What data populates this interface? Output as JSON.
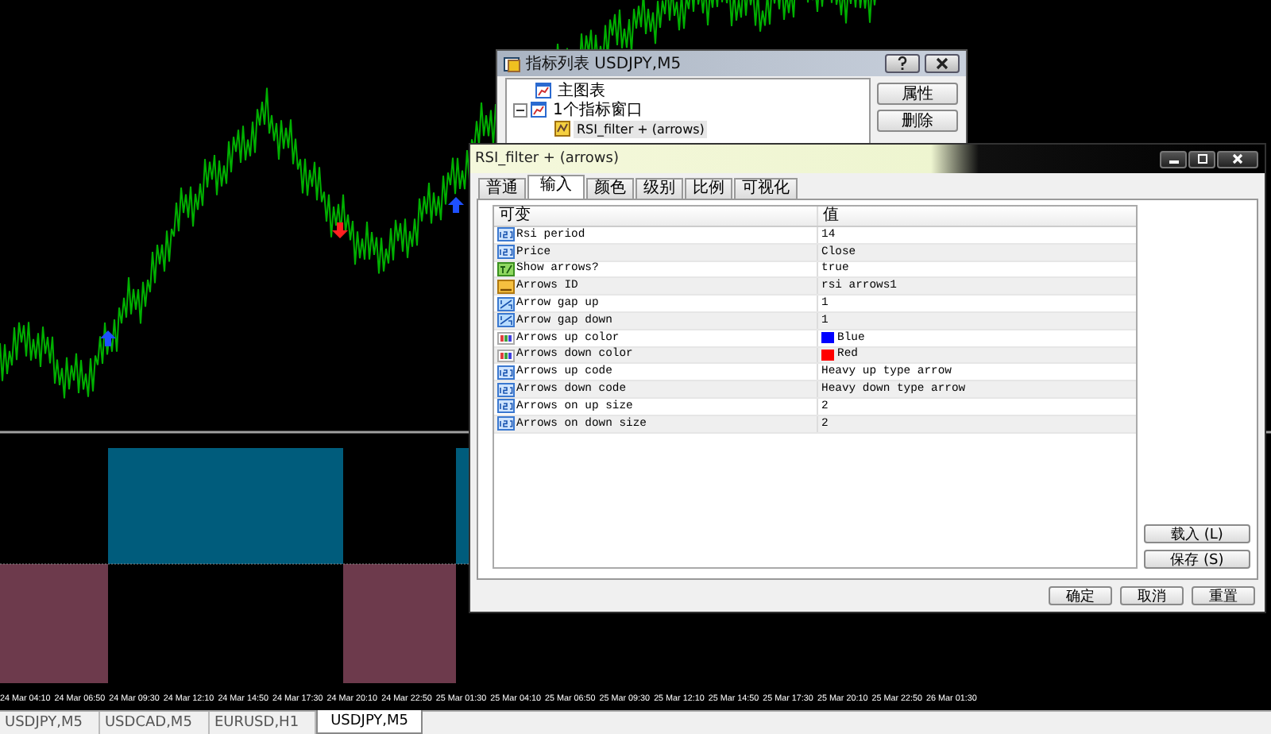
{
  "chart": {
    "time_axis": [
      "24 Mar 04:10",
      "24 Mar 06:50",
      "24 Mar 09:30",
      "24 Mar 12:10",
      "24 Mar 14:50",
      "24 Mar 17:30",
      "24 Mar 20:10",
      "24 Mar 22:50",
      "25 Mar 01:30",
      "25 Mar 04:10",
      "25 Mar 06:50",
      "25 Mar 09:30",
      "25 Mar 12:10",
      "25 Mar 14:50",
      "25 Mar 17:30",
      "25 Mar 20:10",
      "25 Mar 22:50",
      "26 Mar 01:30"
    ]
  },
  "indicator_list_dialog": {
    "title": "指标列表 USDJPY,M5",
    "tree": [
      {
        "label": "主图表",
        "kind": "chart",
        "expanded": false,
        "selected": false
      },
      {
        "label": "1个指标窗口",
        "kind": "chart",
        "expanded": true,
        "selected": false,
        "children": [
          {
            "label": "RSI_filter + (arrows)",
            "kind": "indicator",
            "expanded": false,
            "selected": true
          }
        ]
      }
    ],
    "buttons": [
      "属性",
      "删除"
    ]
  },
  "properties_dialog": {
    "title": "RSI_filter + (arrows)",
    "tabs": [
      {
        "label": "普通",
        "selected": false
      },
      {
        "label": "输入",
        "selected": true
      },
      {
        "label": "颜色",
        "selected": false
      },
      {
        "label": "级别",
        "selected": false
      },
      {
        "label": "比例",
        "selected": false
      },
      {
        "label": "可视化",
        "selected": false
      }
    ],
    "columns": [
      "可变",
      "值"
    ],
    "rows": [
      {
        "kind": "int",
        "name": "Rsi period",
        "value": "14"
      },
      {
        "kind": "int",
        "name": "Price",
        "value": "Close"
      },
      {
        "kind": "bool",
        "name": "Show arrows?",
        "value": "true"
      },
      {
        "kind": "string",
        "name": "Arrows ID",
        "value": "rsi arrows1"
      },
      {
        "kind": "double",
        "name": "Arrow gap up",
        "value": "1"
      },
      {
        "kind": "double",
        "name": "Arrow gap down",
        "value": "1"
      },
      {
        "kind": "color",
        "name": "Arrows up color",
        "value": "Blue",
        "color": "#0000ff"
      },
      {
        "kind": "color",
        "name": "Arrows down color",
        "value": "Red",
        "color": "#ff0000"
      },
      {
        "kind": "int",
        "name": "Arrows up code",
        "value": "Heavy up type arrow"
      },
      {
        "kind": "int",
        "name": "Arrows down code",
        "value": "Heavy down type arrow"
      },
      {
        "kind": "int",
        "name": "Arrows on up size",
        "value": "2"
      },
      {
        "kind": "int",
        "name": "Arrows on down size",
        "value": "2"
      }
    ],
    "side_buttons": [
      "载入 (L)",
      "保存 (S)"
    ],
    "footer_buttons": [
      "确定",
      "取消",
      "重置"
    ]
  },
  "symbol_tabs": [
    {
      "label": "USDJPY,M5",
      "selected": false
    },
    {
      "label": "USDCAD,M5",
      "selected": false
    },
    {
      "label": "EURUSD,H1",
      "selected": false
    },
    {
      "label": "USDJPY,M5",
      "selected": true
    }
  ]
}
